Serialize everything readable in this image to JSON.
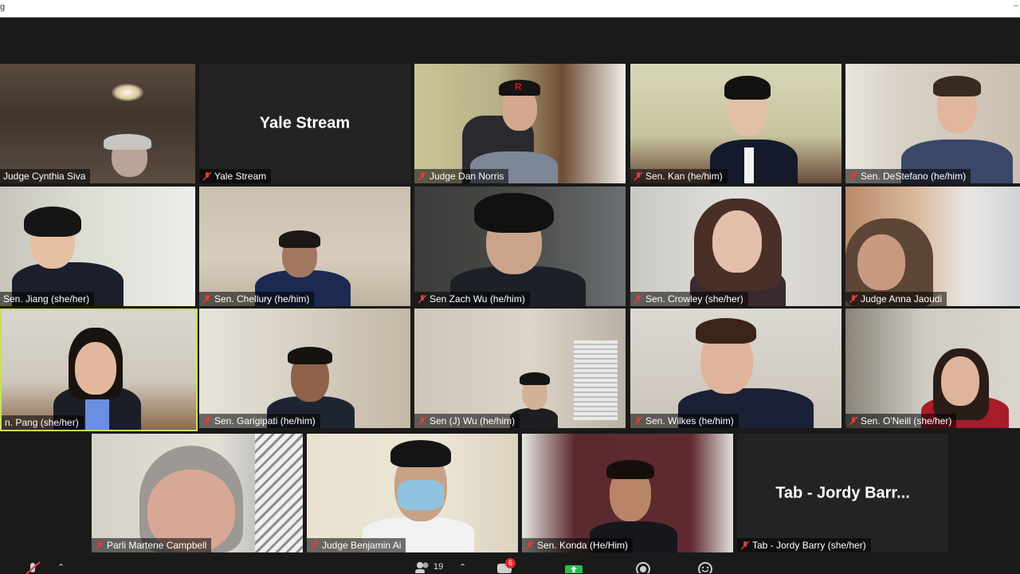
{
  "window": {
    "corner_text": "g",
    "corner_dash": "–"
  },
  "tiles": [
    {
      "name": "Judge Cynthia Siva",
      "muted": false
    },
    {
      "name": "Yale Stream",
      "title": "Yale Stream",
      "muted": true
    },
    {
      "name": "Judge Dan Norris",
      "muted": true
    },
    {
      "name": "Sen. Kan (he/him)",
      "muted": true
    },
    {
      "name": "Sen. DeStefano (he/him)",
      "muted": true
    },
    {
      "name": "Sen. Jiang (she/her)",
      "muted": false
    },
    {
      "name": "Sen. Chellury (he/him)",
      "muted": true
    },
    {
      "name": "Sen Zach Wu (he/him)",
      "muted": true
    },
    {
      "name": "Sen. Crowley (she/her)",
      "muted": true
    },
    {
      "name": "Judge Anna Jaoudi",
      "muted": true
    },
    {
      "name": "n. Pang (she/her)",
      "muted": false,
      "active_speaker": true
    },
    {
      "name": "Sen. Garigipati (he/him)",
      "muted": true
    },
    {
      "name": "Sen (J) Wu (he/him)",
      "muted": true
    },
    {
      "name": "Sen. Wilkes (he/him)",
      "muted": true
    },
    {
      "name": "Sen. O'Neill (she/her)",
      "muted": true
    },
    {
      "name": "Parli Martene Campbell",
      "muted": true
    },
    {
      "name": "Judge Benjamin Ai",
      "muted": true
    },
    {
      "name": "Sen. Konda (He/Him)",
      "muted": true
    },
    {
      "name": "Tab - Jordy Barry (she/her)",
      "title": "Tab - Jordy Barr...",
      "muted": true
    }
  ],
  "toolbar": {
    "participants_count": "19",
    "chat_badge": "6"
  },
  "colors": {
    "muted_icon": "#e23b3b",
    "active_border": "#c8e05a",
    "share_green": "#1fc24a",
    "background": "#1a1a1a"
  }
}
